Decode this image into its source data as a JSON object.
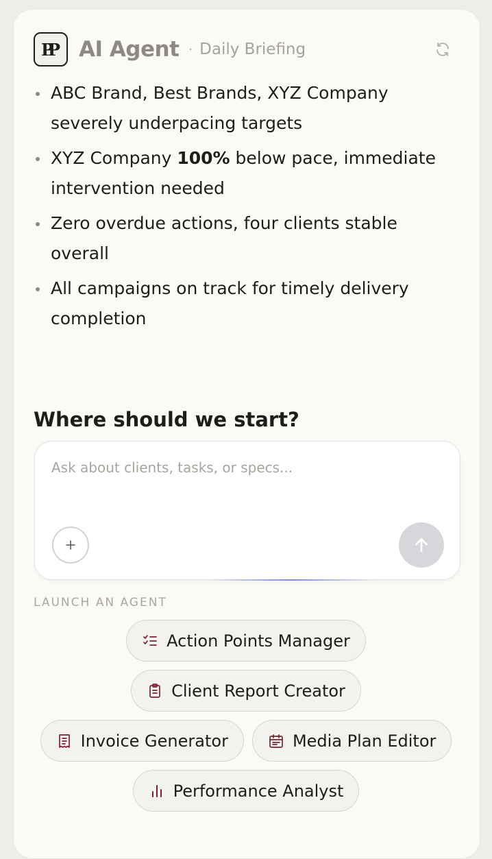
{
  "header": {
    "logo_text": "PP",
    "title": "AI Agent",
    "separator": "·",
    "subtitle": "Daily Briefing",
    "refresh_icon": "refresh-icon"
  },
  "briefing": {
    "items": [
      {
        "text": "ABC Brand, Best Brands, XYZ Company severely underpacing targets"
      },
      {
        "pre": "XYZ Company ",
        "bold": "100%",
        "post": " below pace, immediate intervention needed"
      },
      {
        "text": "Zero overdue actions, four clients stable overall"
      },
      {
        "text": "All campaigns on track for timely delivery completion"
      }
    ]
  },
  "prompt": {
    "heading": "Where should we start?",
    "placeholder": "Ask about clients, tasks, or specs...",
    "value": "",
    "add_icon": "plus-icon",
    "send_icon": "arrow-up-icon"
  },
  "launch": {
    "label": "LAUNCH AN AGENT",
    "agents": [
      {
        "label": "Action Points Manager",
        "icon": "checklist-icon"
      },
      {
        "label": "Client Report Creator",
        "icon": "clipboard-icon"
      },
      {
        "label": "Invoice Generator",
        "icon": "receipt-icon"
      },
      {
        "label": "Media Plan Editor",
        "icon": "calendar-icon"
      },
      {
        "label": "Performance Analyst",
        "icon": "bar-chart-icon"
      }
    ],
    "icon_color": "#7a2330"
  },
  "colors": {
    "card_bg": "#fbfaf7",
    "send_button_disabled": "#d5d7db",
    "title_gray": "#8d8a83"
  }
}
